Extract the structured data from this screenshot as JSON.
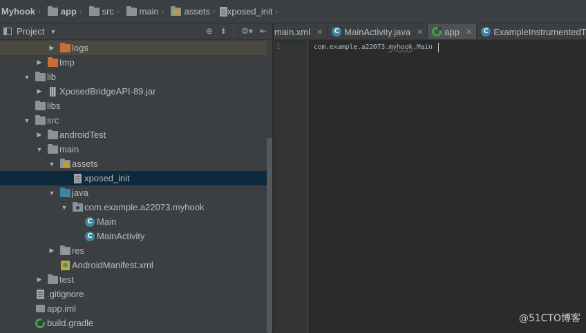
{
  "breadcrumb": {
    "items": [
      {
        "label": "Myhook",
        "bold": true,
        "icon": null
      },
      {
        "label": "app",
        "bold": true,
        "icon": "module-folder-icon"
      },
      {
        "label": "src",
        "bold": false,
        "icon": "folder-icon"
      },
      {
        "label": "main",
        "bold": false,
        "icon": "folder-icon"
      },
      {
        "label": "assets",
        "bold": false,
        "icon": "assets-folder-icon"
      },
      {
        "label": "xposed_init",
        "bold": false,
        "icon": "file-icon"
      }
    ]
  },
  "project_panel": {
    "title": "Project",
    "tool_icons": [
      "locate-icon",
      "collapse-all-icon",
      "settings-icon",
      "hide-panel-icon"
    ]
  },
  "tree": [
    {
      "label": "logs",
      "depth": 3,
      "arrow": "right",
      "icon": "orange-folder-icon"
    },
    {
      "label": "tmp",
      "depth": 2,
      "arrow": "right",
      "icon": "orange-folder-icon"
    },
    {
      "label": "lib",
      "depth": 1,
      "arrow": "down",
      "icon": "folder-icon"
    },
    {
      "label": "XposedBridgeAPI-89.jar",
      "depth": 2,
      "arrow": "right",
      "icon": "jar-icon"
    },
    {
      "label": "libs",
      "depth": 1,
      "arrow": "none",
      "icon": "folder-icon"
    },
    {
      "label": "src",
      "depth": 1,
      "arrow": "down",
      "icon": "folder-icon"
    },
    {
      "label": "androidTest",
      "depth": 2,
      "arrow": "right",
      "icon": "folder-icon"
    },
    {
      "label": "main",
      "depth": 2,
      "arrow": "down",
      "icon": "folder-icon"
    },
    {
      "label": "assets",
      "depth": 3,
      "arrow": "down",
      "icon": "assets-folder-icon"
    },
    {
      "label": "xposed_init",
      "depth": 4,
      "arrow": "none",
      "icon": "file-icon",
      "selected": true
    },
    {
      "label": "java",
      "depth": 3,
      "arrow": "down",
      "icon": "source-folder-icon"
    },
    {
      "label": "com.example.a22073.myhook",
      "depth": 4,
      "arrow": "down",
      "icon": "package-icon"
    },
    {
      "label": "Main",
      "depth": 5,
      "arrow": "none",
      "icon": "class-icon"
    },
    {
      "label": "MainActivity",
      "depth": 5,
      "arrow": "none",
      "icon": "class-icon"
    },
    {
      "label": "res",
      "depth": 3,
      "arrow": "right",
      "icon": "res-folder-icon"
    },
    {
      "label": "AndroidManifest.xml",
      "depth": 3,
      "arrow": "none",
      "icon": "manifest-icon"
    },
    {
      "label": "test",
      "depth": 2,
      "arrow": "right",
      "icon": "folder-icon"
    },
    {
      "label": ".gitignore",
      "depth": 1,
      "arrow": "none",
      "icon": "file-icon"
    },
    {
      "label": "app.iml",
      "depth": 1,
      "arrow": "none",
      "icon": "iml-icon"
    },
    {
      "label": "build.gradle",
      "depth": 1,
      "arrow": "none",
      "icon": "gradle-icon"
    }
  ],
  "tabs": [
    {
      "label": "main.xml",
      "icon": null,
      "active": false
    },
    {
      "label": "MainActivity.java",
      "icon": "class-icon",
      "active": false
    },
    {
      "label": "app",
      "icon": "gradle-icon",
      "active": true
    },
    {
      "label": "ExampleInstrumentedT",
      "icon": "class-icon",
      "active": false
    }
  ],
  "editor": {
    "line_number": "1",
    "code_prefix": "com.example.a22073.",
    "code_typo": "myhook",
    "code_suffix": ".Main"
  },
  "watermark": "@51CTO博客",
  "colors": {
    "panel_bg": "#3c3f41",
    "editor_bg": "#2b2b2b",
    "selection": "#0d293e",
    "class_icon": "#3e86a0",
    "excluded_folder": "#c86e3a"
  }
}
